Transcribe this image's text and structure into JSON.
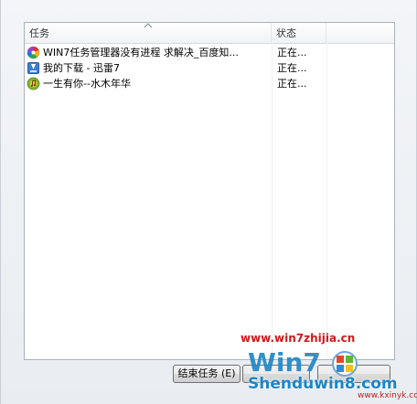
{
  "list": {
    "columns": {
      "task": "任务",
      "status": "状态"
    },
    "rows": [
      {
        "icon": "colorful-app-icon",
        "name": "WIN7任务管理器没有进程 求解决_百度知...",
        "status": "正在..."
      },
      {
        "icon": "xunlei-download-icon",
        "name": "我的下载 - 迅雷7",
        "status": "正在..."
      },
      {
        "icon": "music-player-icon",
        "name": "一生有你--水木年华",
        "status": "正在..."
      }
    ]
  },
  "buttons": {
    "end_task": "结束任务 (E)"
  },
  "watermark": {
    "url": "www.win7zhijia.cn",
    "brand": "Shenduwin8.com",
    "small": "www.kxinyk.com",
    "logo_text": "Win7"
  }
}
